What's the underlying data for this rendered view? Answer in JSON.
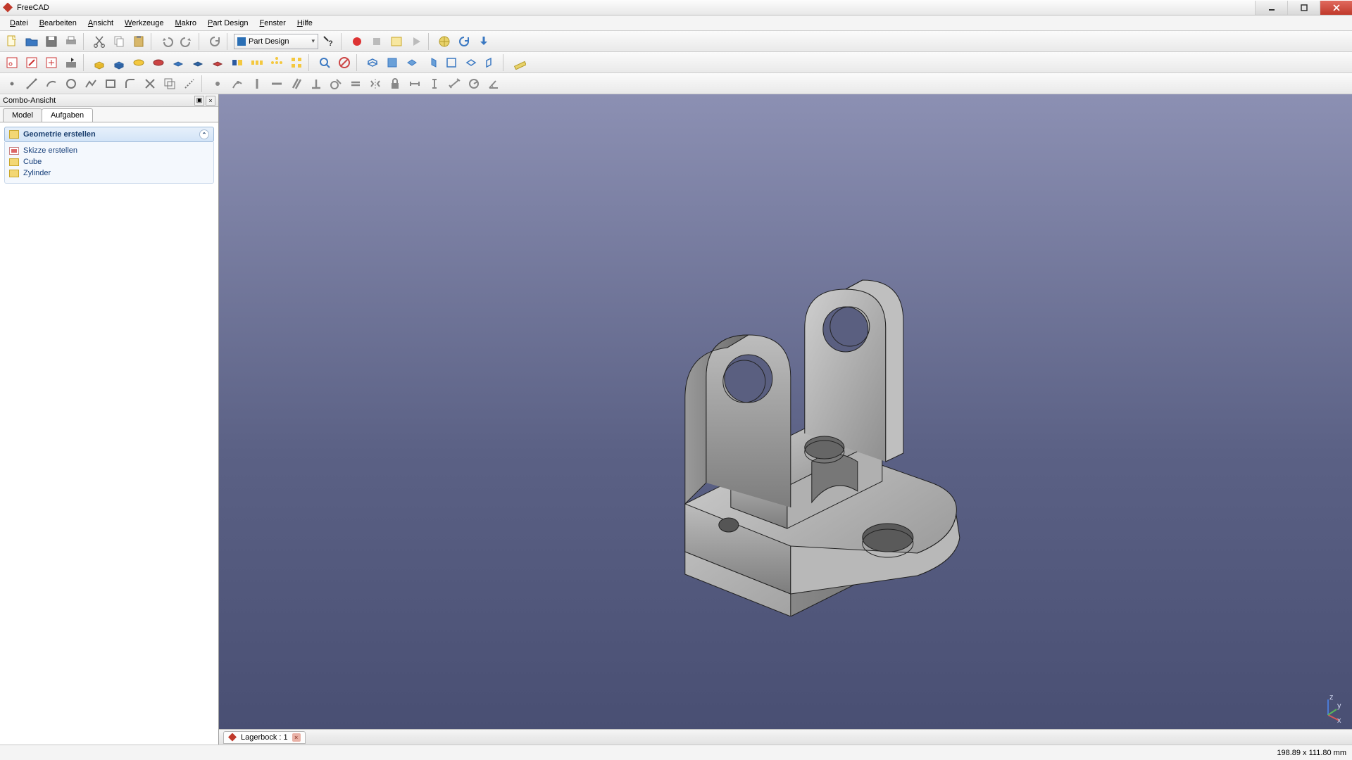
{
  "app": {
    "title": "FreeCAD"
  },
  "menu": [
    "Datei",
    "Bearbeiten",
    "Ansicht",
    "Werkzeuge",
    "Makro",
    "Part Design",
    "Fenster",
    "Hilfe"
  ],
  "workbench_selector": {
    "label": "Part Design"
  },
  "combo": {
    "panel_title": "Combo-Ansicht",
    "tabs": {
      "model": "Model",
      "tasks": "Aufgaben",
      "active": "tasks"
    },
    "geometry_header": "Geometrie erstellen",
    "items": [
      {
        "label": "Skizze erstellen",
        "kind": "link"
      },
      {
        "label": "Cube",
        "kind": "folder"
      },
      {
        "label": "Zylinder",
        "kind": "folder"
      }
    ]
  },
  "document_tab": {
    "label": "Lagerbock : 1"
  },
  "status": {
    "dimensions": "198.89 x 111.80 mm"
  },
  "axis_labels": {
    "x": "x",
    "y": "y",
    "z": "z"
  }
}
